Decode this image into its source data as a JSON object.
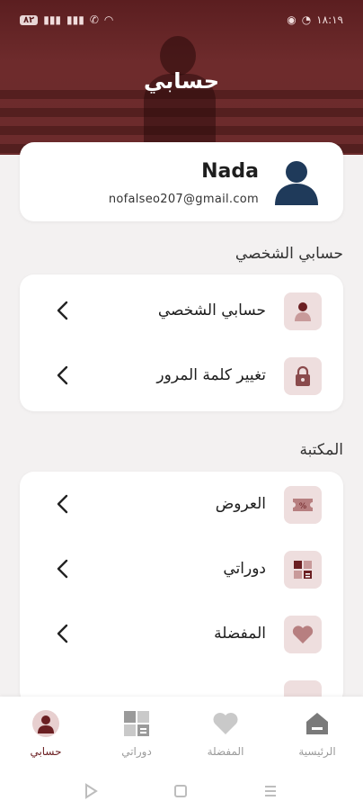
{
  "status_bar": {
    "left": [
      "٨٢",
      "ill",
      "ill",
      "ill"
    ],
    "time": "١٨:١٩"
  },
  "header": {
    "title": "حسابي"
  },
  "profile": {
    "name": "Nada",
    "email": "nofalseo207@gmail.com"
  },
  "sections": [
    {
      "title": "حسابي الشخصي",
      "items": [
        {
          "label": "حسابي الشخصي",
          "icon": "person-icon"
        },
        {
          "label": "تغيير كلمة المرور",
          "icon": "lock-icon"
        }
      ]
    },
    {
      "title": "المكتبة",
      "items": [
        {
          "label": "العروض",
          "icon": "offers-icon"
        },
        {
          "label": "دوراتي",
          "icon": "courses-icon"
        },
        {
          "label": "المفضلة",
          "icon": "heart-icon"
        }
      ]
    }
  ],
  "bottom_nav": {
    "items": [
      {
        "label": "الرئيسية",
        "icon": "home-icon",
        "active": false
      },
      {
        "label": "المفضلة",
        "icon": "heart-icon",
        "active": false
      },
      {
        "label": "دوراتي",
        "icon": "courses-icon",
        "active": false
      },
      {
        "label": "حسابي",
        "icon": "account-icon",
        "active": true
      }
    ]
  },
  "colors": {
    "brand": "#6b1f22",
    "icon_bg": "#eedede",
    "inactive": "#9a9a9a"
  }
}
